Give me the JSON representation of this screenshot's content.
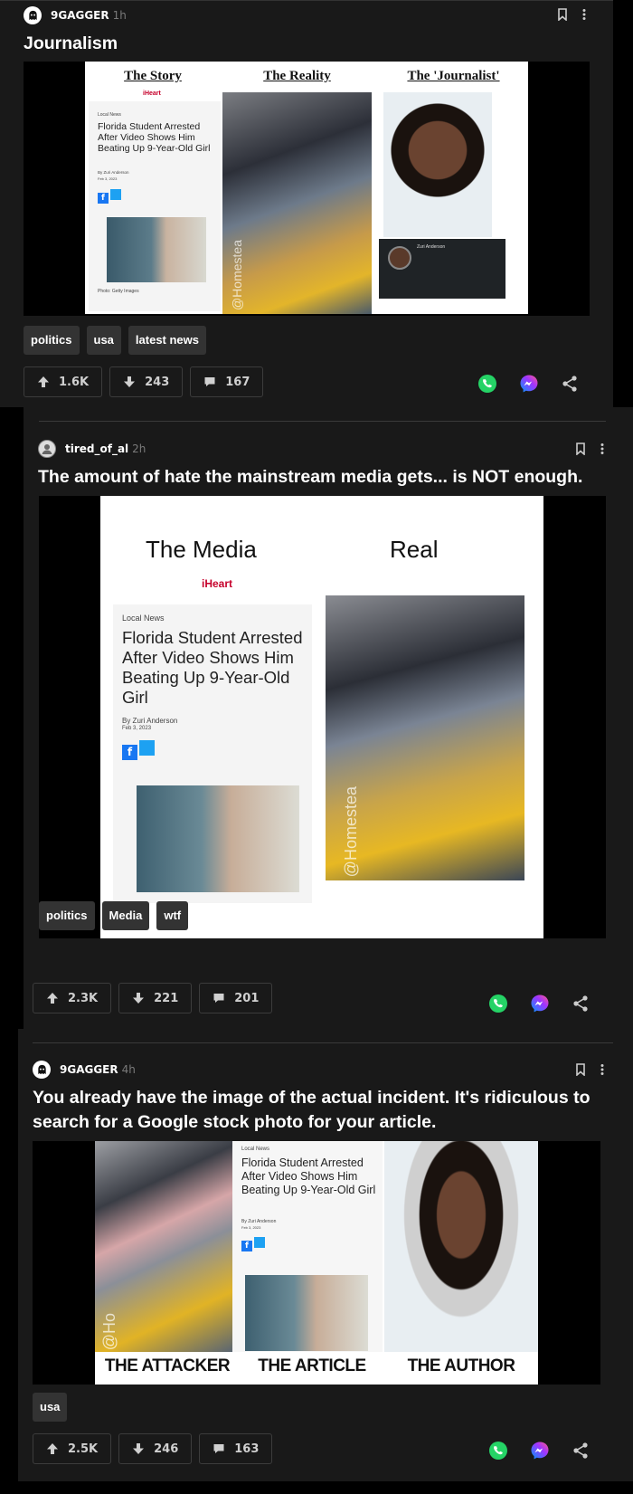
{
  "posts": [
    {
      "author": "9GAGGER",
      "time": "1h",
      "title": "Journalism",
      "meme": {
        "heads": [
          "The Story",
          "The Reality",
          "The 'Journalist'"
        ],
        "brand": "iHeart",
        "category": "Local News",
        "headline": "Florida Student Arrested After Video Shows Him Beating Up 9-Year-Old Girl",
        "byline": "By Zuri Anderson",
        "date": "Feb 3, 2023",
        "photo_credit": "Photo: Getty Images",
        "watermark": "@Homestea",
        "profile_name": "Zuri Anderson"
      },
      "tags": [
        "politics",
        "usa",
        "latest news"
      ],
      "upvotes": "1.6K",
      "downvotes": "243",
      "comments": "167"
    },
    {
      "author": "tired_of_al",
      "time": "2h",
      "title": "The amount of hate the mainstream media gets... is NOT enough.",
      "meme": {
        "heads": [
          "The Media",
          "Real"
        ],
        "brand": "iHeart",
        "category": "Local News",
        "headline": "Florida Student Arrested After Video Shows Him Beating Up 9-Year-Old Girl",
        "byline": "By Zuri Anderson",
        "date": "Feb 3, 2023",
        "watermark": "@Homestea"
      },
      "tags": [
        "politics",
        "Media",
        "wtf"
      ],
      "upvotes": "2.3K",
      "downvotes": "221",
      "comments": "201"
    },
    {
      "author": "9GAGGER",
      "time": "4h",
      "title": "You already have the image of the actual incident. It's ridiculous to search for a Google stock photo for your article.",
      "meme": {
        "captions": [
          "THE ATTACKER",
          "THE ARTICLE",
          "THE AUTHOR"
        ],
        "category": "Local News",
        "headline": "Florida Student Arrested After Video Shows Him Beating Up 9-Year-Old Girl",
        "byline": "By Zuri Anderson",
        "date": "Feb 3, 2023",
        "watermark": "@Ho"
      },
      "tags": [
        "usa"
      ],
      "upvotes": "2.5K",
      "downvotes": "246",
      "comments": "163"
    }
  ],
  "colors": {
    "page_bg": "#000000",
    "post_bg": "#191919",
    "tag_bg": "#333333",
    "whatsapp": "#25d366",
    "messenger_a": "#0099ff",
    "messenger_b": "#ff4f8b"
  }
}
